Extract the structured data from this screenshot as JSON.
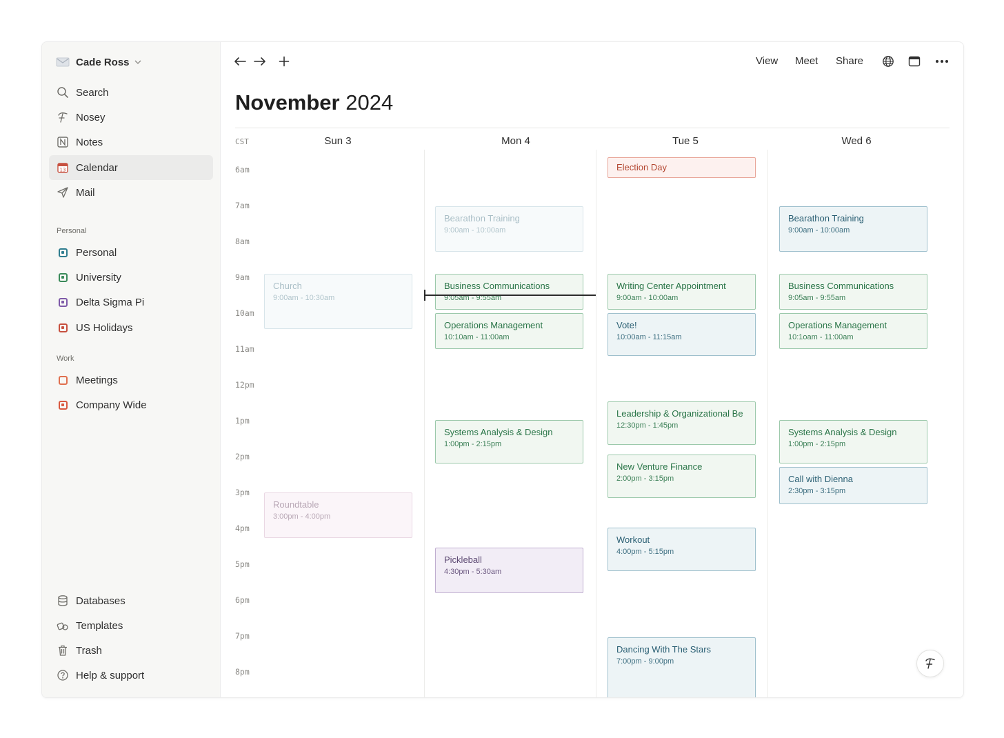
{
  "sidebar": {
    "user": "Cade Ross",
    "nav": [
      {
        "label": "Search",
        "icon": "search-icon"
      },
      {
        "label": "Nosey",
        "icon": "nosey-icon"
      },
      {
        "label": "Notes",
        "icon": "notes-icon"
      },
      {
        "label": "Calendar",
        "icon": "calendar-icon",
        "active": true
      },
      {
        "label": "Mail",
        "icon": "mail-icon"
      }
    ],
    "personal_heading": "Personal",
    "personal": [
      {
        "label": "Personal",
        "color": "#2f7d8f"
      },
      {
        "label": "University",
        "color": "#3a8a5a"
      },
      {
        "label": "Delta Sigma Pi",
        "color": "#7e5aa8"
      },
      {
        "label": "US Holidays",
        "color": "#c7503f"
      }
    ],
    "work_heading": "Work",
    "work": [
      {
        "label": "Meetings",
        "color": "#e0704f"
      },
      {
        "label": "Company Wide",
        "color": "#d9583f"
      }
    ],
    "bottom": [
      {
        "label": "Databases",
        "icon": "database-icon"
      },
      {
        "label": "Templates",
        "icon": "templates-icon"
      },
      {
        "label": "Trash",
        "icon": "trash-icon"
      },
      {
        "label": "Help & support",
        "icon": "help-icon"
      }
    ]
  },
  "toolbar": {
    "view": "View",
    "meet": "Meet",
    "share": "Share"
  },
  "header": {
    "month": "November",
    "year": "2024"
  },
  "grid": {
    "timezone": "CST",
    "days": [
      "Sun 3",
      "Mon 4",
      "Tue 5",
      "Wed 6"
    ],
    "hours": [
      "6am",
      "7am",
      "8am",
      "9am",
      "10am",
      "11am",
      "12pm",
      "1pm",
      "2pm",
      "3pm",
      "4pm",
      "5pm",
      "6pm",
      "7pm",
      "8pm"
    ]
  },
  "events": {
    "sun": [
      {
        "title": "Church",
        "time": "9:00am - 10:30am"
      },
      {
        "title": "Roundtable",
        "time": "3:00pm - 4:00pm"
      }
    ],
    "mon": [
      {
        "title": "Bearathon Training",
        "time": "9:00am - 10:00am"
      },
      {
        "title": "Business Communications",
        "time": "9:05am - 9:55am"
      },
      {
        "title": "Operations Management",
        "time": "10:10am - 11:00am"
      },
      {
        "title": "Systems Analysis & Design",
        "time": "1:00pm - 2:15pm"
      },
      {
        "title": "Pickleball",
        "time": "4:30pm - 5:30am"
      }
    ],
    "tue": [
      {
        "title": "Election Day"
      },
      {
        "title": "Writing Center Appointment",
        "time": "9:00am - 10:00am"
      },
      {
        "title": "Vote!",
        "time": "10:00am - 11:15am"
      },
      {
        "title": "Leadership & Organizational Be",
        "time": "12:30pm - 1:45pm"
      },
      {
        "title": "New Venture Finance",
        "time": "2:00pm - 3:15pm"
      },
      {
        "title": "Workout",
        "time": "4:00pm - 5:15pm"
      },
      {
        "title": "Dancing With The Stars",
        "time": "7:00pm - 9:00pm"
      }
    ],
    "wed": [
      {
        "title": "Bearathon Training",
        "time": "9:00am - 10:00am"
      },
      {
        "title": "Business Communications",
        "time": "9:05am - 9:55am"
      },
      {
        "title": "Operations Management",
        "time": "10:1oam - 11:00am"
      },
      {
        "title": "Systems Analysis & Design",
        "time": "1:00pm - 2:15pm"
      },
      {
        "title": "Call with Dienna",
        "time": "2:30pm - 3:15pm"
      }
    ]
  }
}
